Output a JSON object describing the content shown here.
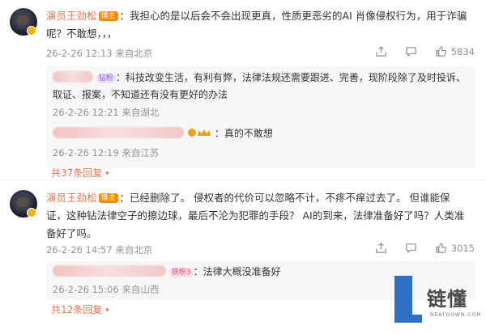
{
  "comments": [
    {
      "author": "演员王劲松",
      "role_badge": "博主",
      "text": "：我担心的是以后会不会出现更真，性质更恶劣的AI 肖像侵权行为，用于诈骗呢？不敢想，，，",
      "meta": "26-2-26 12:13 来自北京",
      "likes": "5834",
      "replies": [
        {
          "user_badge": "钻粉",
          "text": "：科技改变生活，有利有弊，法律法规还需要跟进、完善，现阶段除了及时投诉、取证、报案，不知道还有没有更好的办法",
          "meta": "26-2-26 12:21 来自湖北"
        },
        {
          "text": "：真的不敢想",
          "meta": "26-2-26 12:19 来自江苏"
        }
      ],
      "more": "共37条回复"
    },
    {
      "author": "演员王劲松",
      "role_badge": "博主",
      "text": "：已经删除了。 侵权者的代价可以忽略不计，不疼不痒过去了。 但谁能保证，这种钻法律空子的擦边球，最后不沦为犯罪的手段？ AI的到来，法律准备好了吗？人类准备好了吗。",
      "meta": "26-2-26 14:57 来自北京",
      "likes": "3015",
      "replies": [
        {
          "user_badge": "铁粉3",
          "text": "：法律大概没准备好",
          "meta": "26-2-26 15:06 来自山西"
        }
      ],
      "more": "共12条回复"
    }
  ],
  "watermark": {
    "logo_text": "链懂",
    "sub_text": "NEATDOWN.COM",
    "color": "#2f6fc4"
  },
  "colors": {
    "author": "#eb7350",
    "meta": "#939393",
    "reply_bg": "#f7f7f7"
  }
}
